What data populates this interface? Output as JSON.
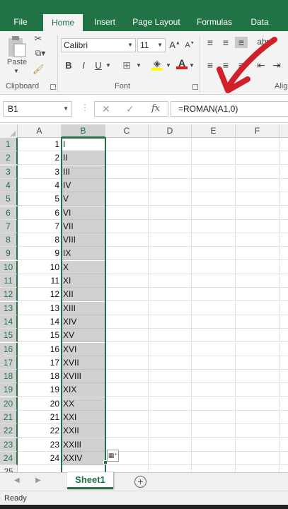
{
  "ribbon_tabs": [
    "File",
    "Home",
    "Insert",
    "Page Layout",
    "Formulas",
    "Data"
  ],
  "active_tab": "Home",
  "clipboard": {
    "paste_label": "Paste",
    "group_label": "Clipboard"
  },
  "font": {
    "name": "Calibri",
    "size": "11",
    "group_label": "Font",
    "bold": "B",
    "italic": "I",
    "underline": "U",
    "grow": "A",
    "shrink": "A"
  },
  "alignment": {
    "group_label": "Alig"
  },
  "namebox": "B1",
  "formula": "=ROMAN(A1,0)",
  "fx_label": "fx",
  "columns": [
    "A",
    "B",
    "C",
    "D",
    "E",
    "F"
  ],
  "rows": [
    "1",
    "2",
    "3",
    "4",
    "5",
    "6",
    "7",
    "8",
    "9",
    "10",
    "11",
    "12",
    "13",
    "14",
    "15",
    "16",
    "17",
    "18",
    "19",
    "20",
    "21",
    "22",
    "23",
    "24",
    "25"
  ],
  "col_a_values": [
    "1",
    "2",
    "3",
    "4",
    "5",
    "6",
    "7",
    "8",
    "9",
    "10",
    "11",
    "12",
    "13",
    "14",
    "15",
    "16",
    "17",
    "18",
    "19",
    "20",
    "21",
    "22",
    "23",
    "24"
  ],
  "col_b_values": [
    "I",
    "II",
    "III",
    "IV",
    "V",
    "VI",
    "VII",
    "VIII",
    "IX",
    "X",
    "XI",
    "XII",
    "XIII",
    "XIV",
    "XV",
    "XVI",
    "XVII",
    "XVIII",
    "XIX",
    "XX",
    "XXI",
    "XXII",
    "XXIII",
    "XXIV"
  ],
  "sheet_tab": "Sheet1",
  "status": "Ready",
  "colors": {
    "excel_green": "#217346",
    "annotation_red": "#d0202a",
    "selection_fill": "#d0d0d0"
  }
}
